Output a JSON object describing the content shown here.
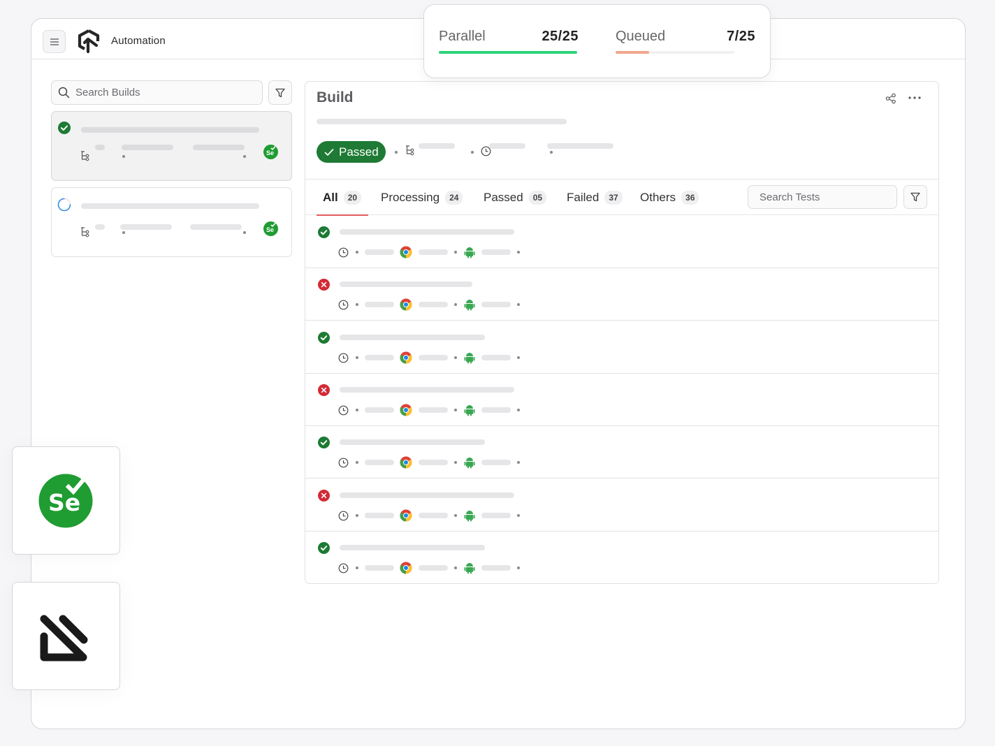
{
  "app": {
    "title": "Automation",
    "icons": {
      "menu": "hamburger-menu-icon",
      "logo": "lambdatest-logo-icon"
    }
  },
  "concurrency": {
    "parallel": {
      "label": "Parallel",
      "value": "25/25",
      "used": 25,
      "total": 25,
      "color": "#2ed47a"
    },
    "queued": {
      "label": "Queued",
      "value": "7/25",
      "used": 7,
      "total": 25,
      "color": "#f2a68d"
    }
  },
  "sidebar": {
    "search": {
      "placeholder": "Search Builds",
      "value": ""
    },
    "builds": [
      {
        "status": "passed",
        "active": true,
        "framework": "selenium"
      },
      {
        "status": "running",
        "active": false,
        "framework": "selenium"
      }
    ]
  },
  "build": {
    "title": "Build",
    "status_label": "Passed",
    "actions": [
      "share-icon",
      "more-options-icon"
    ],
    "tabs": [
      {
        "label": "All",
        "count": "20",
        "active": true
      },
      {
        "label": "Processing",
        "count": "24",
        "active": false
      },
      {
        "label": "Passed",
        "count": "05",
        "active": false
      },
      {
        "label": "Failed",
        "count": "37",
        "active": false
      },
      {
        "label": "Others",
        "count": "36",
        "active": false
      }
    ],
    "tests_search": {
      "placeholder": "Search Tests",
      "value": ""
    },
    "tests": [
      {
        "status": "passed",
        "browser": "chrome",
        "os": "android"
      },
      {
        "status": "failed",
        "browser": "chrome",
        "os": "android"
      },
      {
        "status": "passed",
        "browser": "chrome",
        "os": "android"
      },
      {
        "status": "failed",
        "browser": "chrome",
        "os": "android"
      },
      {
        "status": "passed",
        "browser": "chrome",
        "os": "android"
      },
      {
        "status": "failed",
        "browser": "chrome",
        "os": "android"
      },
      {
        "status": "passed",
        "browser": "chrome",
        "os": "android"
      }
    ]
  },
  "integrations": [
    {
      "name": "Selenium",
      "icon": "selenium-logo-icon",
      "color": "#1f9c32"
    },
    {
      "name": "Playwright-style",
      "icon": "automation-framework-logo-icon",
      "color": "#1a1a1a"
    }
  ],
  "colors": {
    "passed": "#1e7a34",
    "failed": "#d42a35",
    "running": "#3a8ee6",
    "tab_underline": "#e25c5c"
  }
}
